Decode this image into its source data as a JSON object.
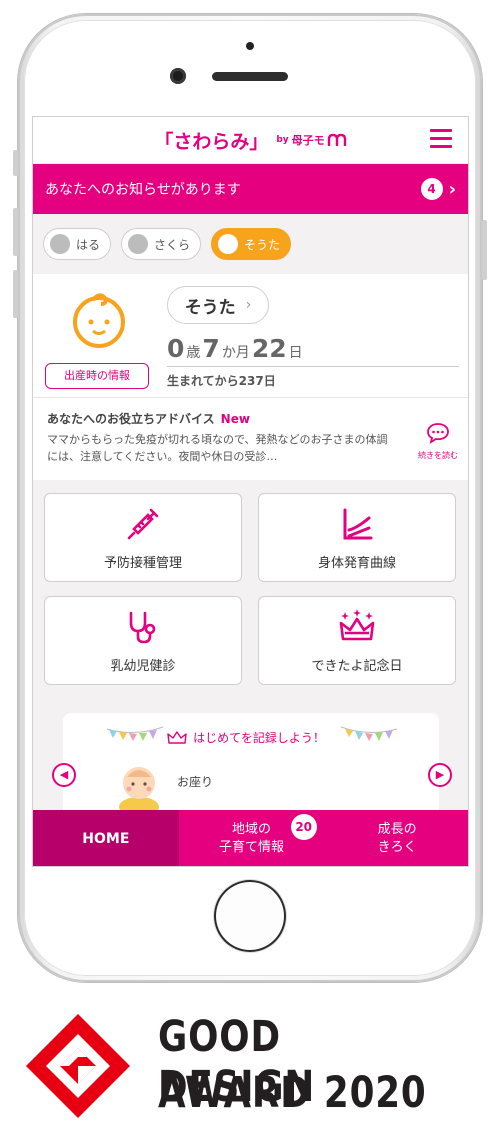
{
  "header": {
    "title": "「さわらみ」",
    "by": "by",
    "brand": "母子モ"
  },
  "notice": {
    "text": "あなたへのお知らせがあります",
    "count": "4"
  },
  "children": [
    {
      "name": "はる",
      "active": false
    },
    {
      "name": "さくら",
      "active": false
    },
    {
      "name": "そうた",
      "active": true
    }
  ],
  "profile": {
    "name": "そうた",
    "birth_info_label": "出産時の情報",
    "age": {
      "years": "0",
      "years_unit": "歳",
      "months": "7",
      "months_unit": "か月",
      "days": "22",
      "days_unit": "日"
    },
    "days_since_birth": "生まれてから237日"
  },
  "advice": {
    "title": "あなたへのお役立ちアドバイス",
    "badge": "New",
    "text": "ママからもらった免疫が切れる頃なので、発熱などのお子さまの体調には、注意してください。夜間や休日の受診…",
    "read_more": "続きを読む"
  },
  "tiles": [
    {
      "label": "予防接種管理",
      "icon": "syringe-icon"
    },
    {
      "label": "身体発育曲線",
      "icon": "growth-chart-icon"
    },
    {
      "label": "乳幼児健診",
      "icon": "stethoscope-icon"
    },
    {
      "label": "できたよ記念日",
      "icon": "crown-icon"
    }
  ],
  "firsts": {
    "title": "はじめてを記録しよう！",
    "item": "お座り"
  },
  "tabbar": {
    "home": "HOME",
    "local_line1": "地域の",
    "local_line2": "子育て情報",
    "local_badge": "20",
    "growth_line1": "成長の",
    "growth_line2": "きろく"
  },
  "award": {
    "line1": "GOOD DESIGN",
    "line2": "AWARD 2020"
  },
  "colors": {
    "brand": "#e4007f",
    "accent": "#f8a31c"
  }
}
